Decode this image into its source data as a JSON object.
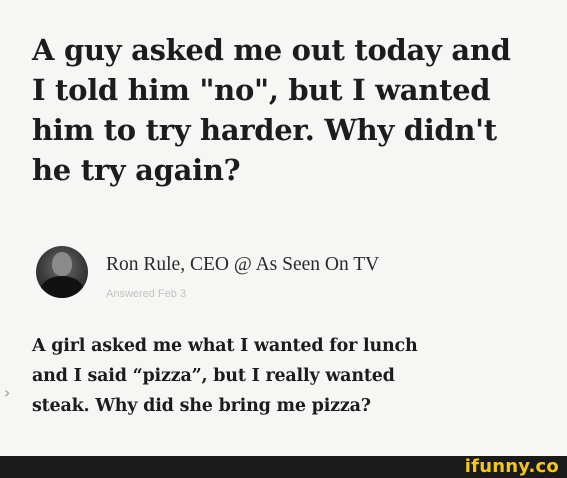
{
  "question": {
    "lines": [
      "A guy asked me out today and",
      "I told him \"no\", but I wanted",
      "him to try harder. Why didn't",
      "he try again?"
    ]
  },
  "author": {
    "name": "Ron Rule, CEO @ As Seen On TV",
    "answered": "Answered Feb 3",
    "avatar_icon": "profile-photo"
  },
  "answer": {
    "lines": [
      "A girl asked me what I wanted for lunch",
      "and I said “pizza”, but I really wanted",
      "steak. Why did she bring me pizza?"
    ]
  },
  "side": {
    "chevron_icon": "chevron-right-icon",
    "chevron_glyph": "›"
  },
  "footer": {
    "brand": "ifunny.co",
    "background": "#1a1a1a",
    "brand_color": "#f2c81f"
  }
}
